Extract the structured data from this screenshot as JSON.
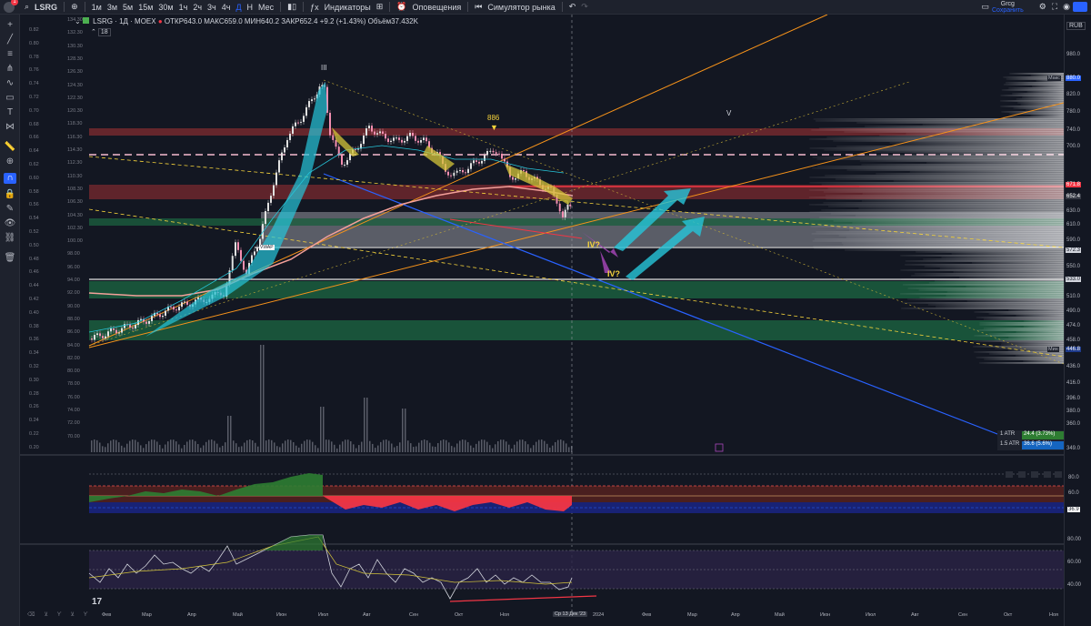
{
  "topbar": {
    "symbol": "LSRG",
    "intervals": [
      "1м",
      "3м",
      "5м",
      "15м",
      "30м",
      "1ч",
      "2ч",
      "3ч",
      "4ч",
      "Д",
      "Н",
      "Мес"
    ],
    "active_interval": "Д",
    "indicators_label": "Индикаторы",
    "alerts_label": "Оповещения",
    "replay_label": "Симулятор рынка",
    "layout_name": "Grcg",
    "save_label": "Сохранить",
    "notification_count": "1"
  },
  "legend": {
    "title": "LSRG · 1Д · MOEX",
    "ohlc": "ОТКР643.0  МАКС659.0  МИН640.2  ЗАКР652.4  +9.2 (+1.43%)  Объём37.432K",
    "indicator_count": "18"
  },
  "price_axis": {
    "currency": "RUB",
    "ticks": [
      "980.0",
      "880.0",
      "820.0",
      "780.0",
      "740.0",
      "700.0",
      "652.4",
      "630.0",
      "610.0",
      "590.0",
      "572.3",
      "550.0",
      "533.0",
      "510.0",
      "490.0",
      "474.0",
      "458.0",
      "446.8",
      "436.0",
      "416.0",
      "396.0",
      "380.0",
      "360.0",
      "349.0"
    ],
    "last_price": "652.4",
    "level_top": "880.0",
    "level_red": "671.8",
    "level_572": "572.3",
    "level_533": "533.0",
    "level_low": "446.8",
    "max_label": "Макс",
    "min_label": "Мин"
  },
  "left_scale": [
    "0.82",
    "0.80",
    "0.78",
    "0.76",
    "0.74",
    "0.72",
    "0.70",
    "0.68",
    "0.66",
    "0.64",
    "0.62",
    "0.60",
    "0.58",
    "0.56",
    "0.54",
    "0.52",
    "0.50",
    "0.48",
    "0.46",
    "0.44",
    "0.42",
    "0.40",
    "0.38",
    "0.36",
    "0.34",
    "0.32",
    "0.30",
    "0.28",
    "0.26",
    "0.24",
    "0.22",
    "0.20"
  ],
  "left_scale2": [
    "134.30",
    "132.30",
    "130.30",
    "128.30",
    "126.30",
    "124.30",
    "122.30",
    "120.30",
    "118.30",
    "116.30",
    "114.30",
    "112.30",
    "110.30",
    "108.30",
    "106.30",
    "104.30",
    "102.30",
    "100.00",
    "98.00",
    "96.00",
    "94.00",
    "92.00",
    "90.00",
    "88.00",
    "86.00",
    "84.00",
    "82.00",
    "80.00",
    "78.00",
    "76.00",
    "74.00",
    "72.00",
    "70.00"
  ],
  "x_axis": [
    "Фев",
    "Мар",
    "Апр",
    "Май",
    "Июн",
    "Июл",
    "Авг",
    "Сен",
    "Окт",
    "Ноя",
    "Дек",
    "2024",
    "Фев",
    "Мар",
    "Апр",
    "Май",
    "Июн",
    "Июл",
    "Авг",
    "Сен",
    "Окт",
    "Ноя"
  ],
  "crosshair_date": "Ср 13 Дек '23",
  "annotations": {
    "wave_iii": "III",
    "wave_v": "V",
    "level_886": "886",
    "wave_iv_a": "IV?",
    "wave_iv_b": "IV?",
    "vwap": "VWAP"
  },
  "atr": {
    "label1": "1 ATR",
    "value1": "24.4 (3.73%)",
    "label2": "1.5 ATR",
    "value2": "36.6 (5.6%)"
  },
  "pane1_axis": [
    "80.0",
    "60.0",
    "40.0",
    "36.9"
  ],
  "pane2_axis": [
    "80.00",
    "60.00",
    "40.00"
  ],
  "colors": {
    "bg": "#131722",
    "up": "#26a69a",
    "down": "#ef5350",
    "accent": "#2962ff",
    "orange": "#f7931a"
  }
}
